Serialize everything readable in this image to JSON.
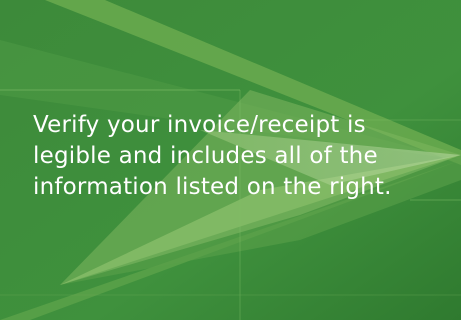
{
  "message": {
    "text": "Verify your invoice/receipt is\nlegible and includes all of the\ninformation listed on the right."
  },
  "colors": {
    "background": "#3f8f3c",
    "arrow_light": "#8fc46b",
    "arrow_mid": "#6aaa4f",
    "text": "#ffffff"
  }
}
